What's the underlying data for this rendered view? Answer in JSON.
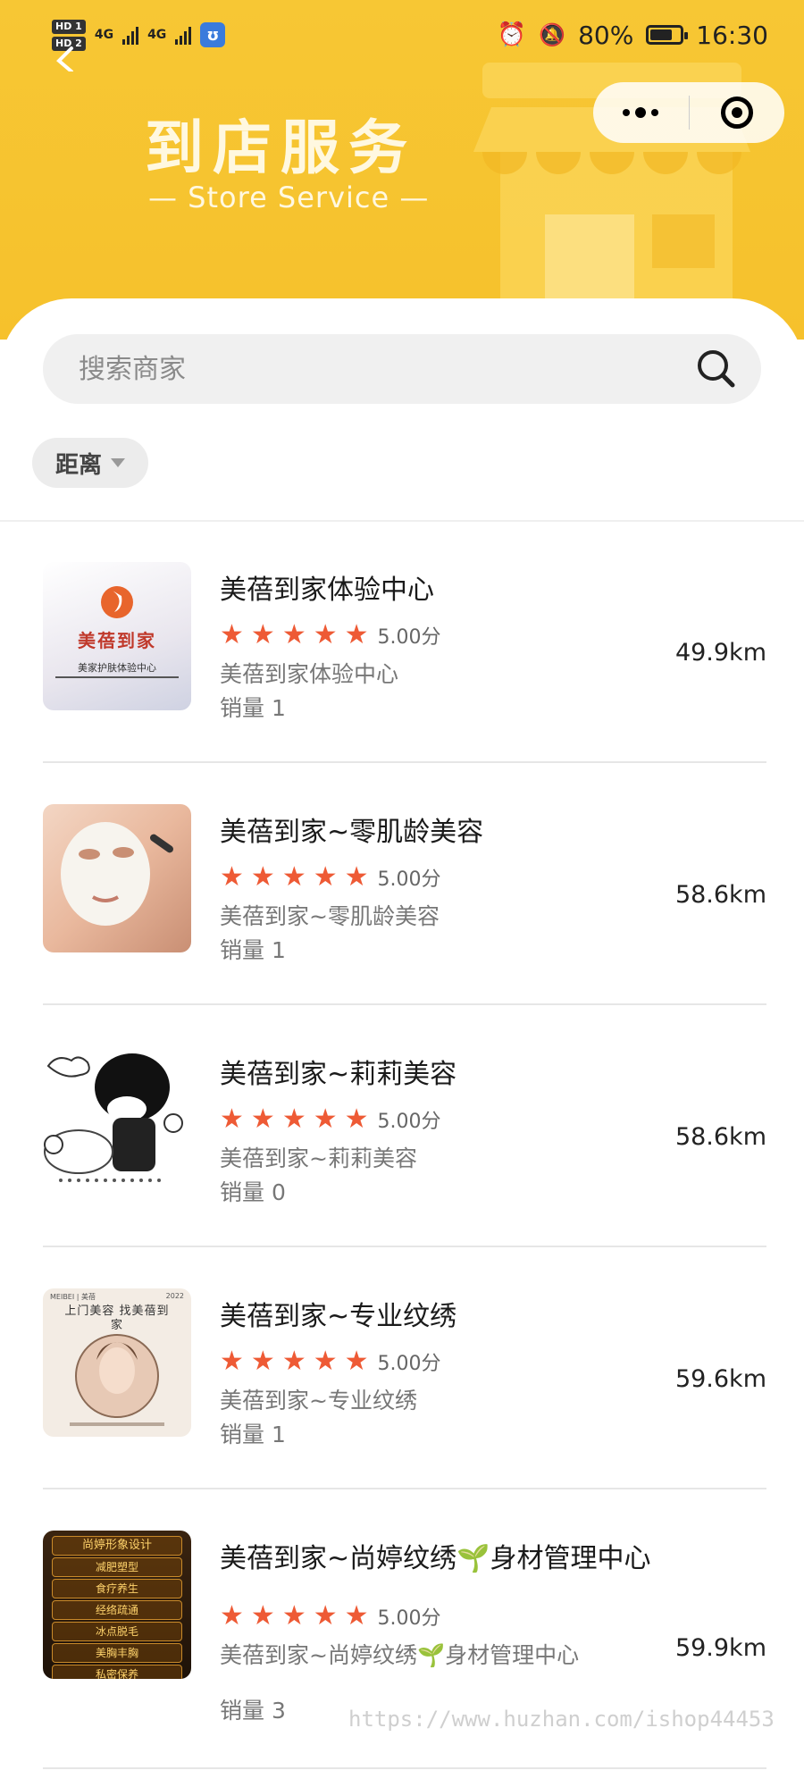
{
  "status_bar": {
    "hd1": "HD 1",
    "hd2": "HD 2",
    "net1": "4G",
    "net2": "4G",
    "battery_pct": "80%",
    "battery_level": 0.8,
    "time": "16:30"
  },
  "header": {
    "title": "到店服务",
    "subtitle": "— Store Service —",
    "bg_color": "#f6c12c"
  },
  "search": {
    "placeholder": "搜索商家"
  },
  "filter": {
    "label": "距离"
  },
  "stores": [
    {
      "name": "美蓓到家体验中心",
      "score": "5.00分",
      "subtitle": "美蓓到家体验中心",
      "sales": "销量 1",
      "distance": "49.9km",
      "stars": 5,
      "thumb": "logo",
      "thumb_text": "美蓓到家",
      "thumb_caption": "美家护肤体验中心"
    },
    {
      "name": "美蓓到家~零肌龄美容",
      "score": "5.00分",
      "subtitle": "美蓓到家~零肌龄美容",
      "sales": "销量 1",
      "distance": "58.6km",
      "stars": 5,
      "thumb": "face-mask"
    },
    {
      "name": "美蓓到家~莉莉美容",
      "score": "5.00分",
      "subtitle": "美蓓到家~莉莉美容",
      "sales": "销量 0",
      "distance": "58.6km",
      "stars": 5,
      "thumb": "cartoon"
    },
    {
      "name": "美蓓到家~专业纹绣",
      "score": "5.00分",
      "subtitle": "美蓓到家~专业纹绣",
      "sales": "销量 1",
      "distance": "59.6km",
      "stars": 5,
      "thumb": "poster",
      "thumb_text": "上门美容 找美蓓到家",
      "thumb_year": "2022",
      "thumb_brand": "MEIBEI | 美蓓"
    },
    {
      "name": "美蓓到家~尚婷纹绣🌱身材管理中心",
      "score": "5.00分",
      "subtitle": "美蓓到家~尚婷纹绣🌱身材管理中心",
      "sales": "销量 3",
      "distance": "59.9km",
      "stars": 5,
      "thumb": "signboard",
      "thumb_lines": [
        "尚婷形象设计",
        "减肥塑型",
        "食疗养生",
        "经络疏通",
        "冰点脱毛",
        "美胸丰胸",
        "私密保养"
      ]
    }
  ],
  "watermark": "https://www.huzhan.com/ishop44453"
}
